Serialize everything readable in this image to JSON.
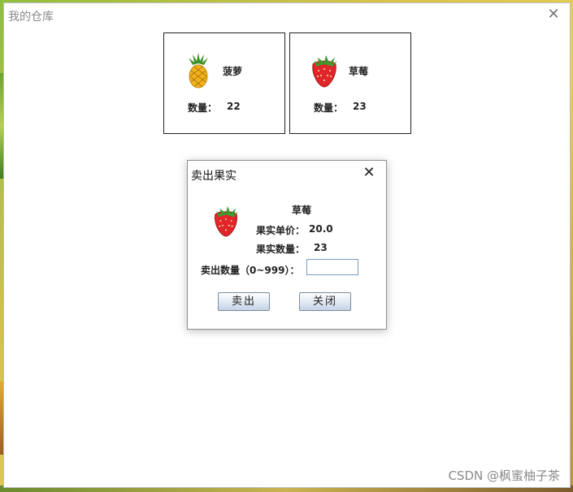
{
  "main_window": {
    "title": "我的仓库",
    "close_glyph": "✕"
  },
  "cards": [
    {
      "name": "菠萝",
      "qty_label": "数量：",
      "qty": "22",
      "icon": "pineapple-icon"
    },
    {
      "name": "草莓",
      "qty_label": "数量：",
      "qty": "23",
      "icon": "strawberry-icon"
    }
  ],
  "dialog": {
    "title": "卖出果实",
    "close_glyph": "✕",
    "fruit_name": "草莓",
    "fruit_icon": "strawberry-icon",
    "price_label": "果实单价：",
    "price_value": "20.0",
    "qty_label": "果实数量：",
    "qty_value": "23",
    "sell_qty_label": "卖出数量（0~999）：",
    "sell_qty_input_value": "",
    "sell_button": "卖出",
    "close_button": "关闭"
  },
  "watermark": "CSDN @枫蜜柚子茶"
}
